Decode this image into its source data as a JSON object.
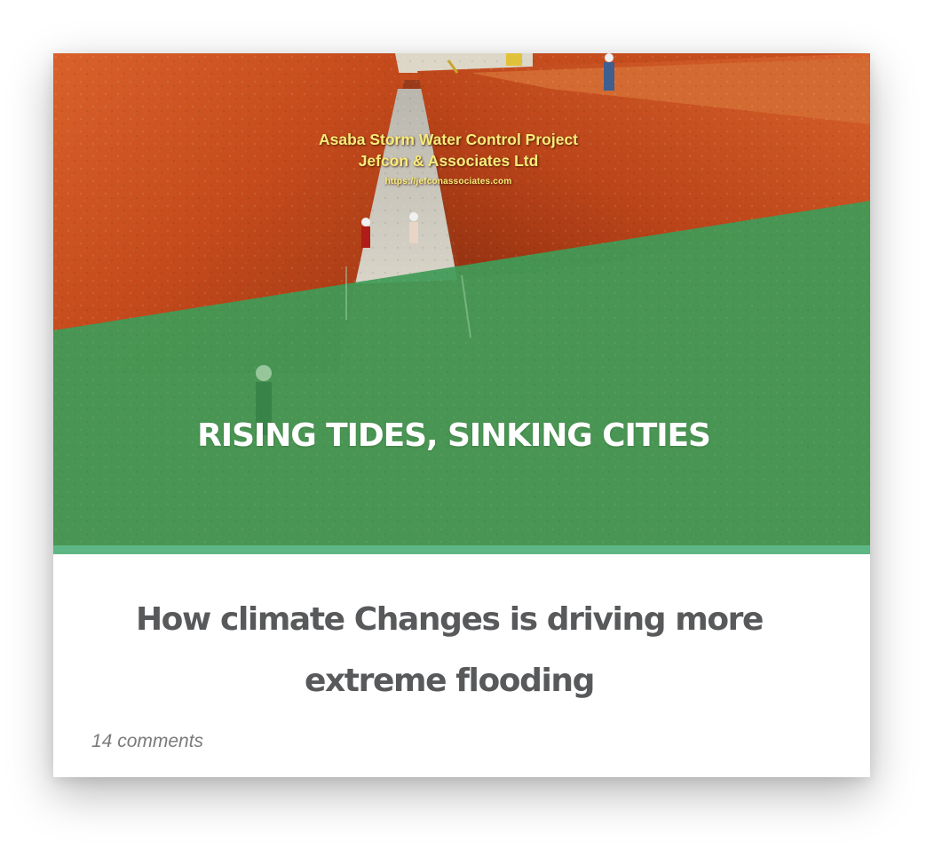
{
  "card": {
    "image_caption": {
      "line1": "Asaba Storm Water Control Project",
      "line2": "Jefcon & Associates Ltd",
      "url": "https://jefconassociates.com"
    },
    "banner_title": "RISING TIDES, SINKING CITIES",
    "headline": "How climate Changes is driving more extreme flooding",
    "comments_label": "14 comments"
  },
  "colors": {
    "banner_green": "#3f9b57",
    "accent_bar": "#5cb784",
    "headline_text": "#58595b",
    "soil": "#c0461b"
  }
}
